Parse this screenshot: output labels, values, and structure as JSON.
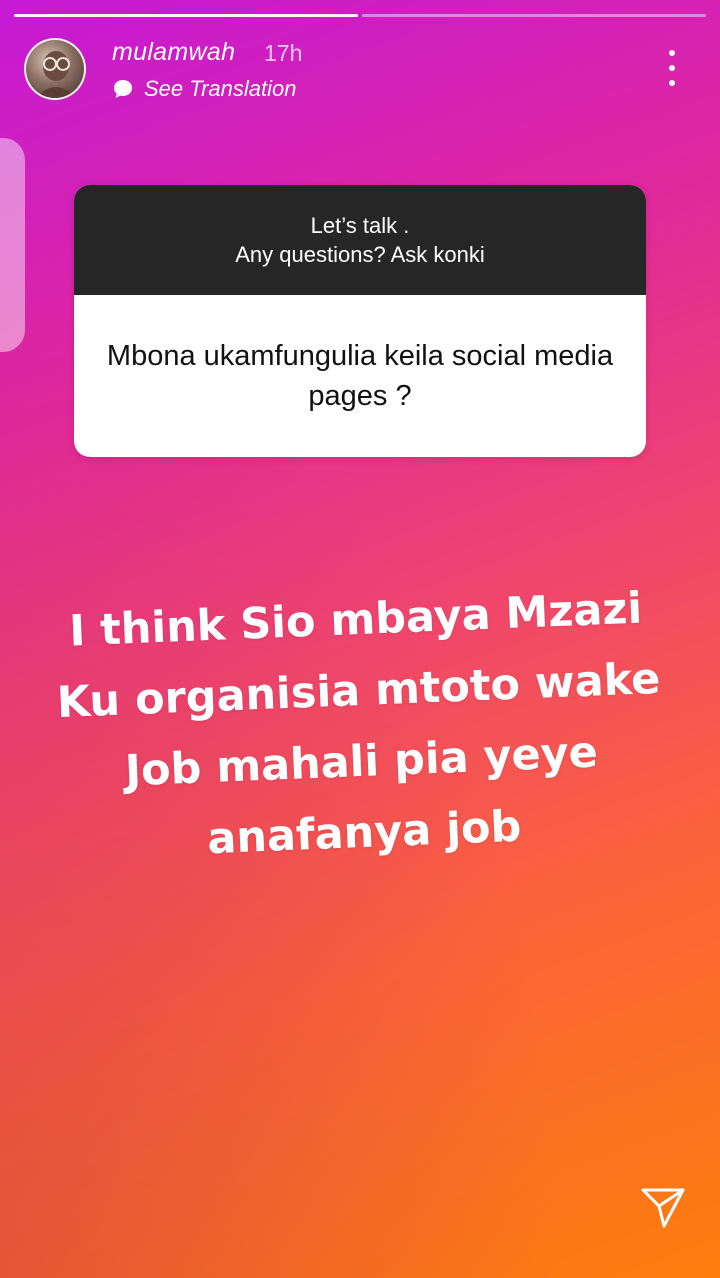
{
  "story": {
    "username": "mulamwah",
    "timestamp": "17h",
    "translation_label": "See Translation",
    "progress": {
      "segments": 2,
      "completed": 1
    }
  },
  "question_sticker": {
    "prompt_line1": "Let’s talk .",
    "prompt_line2": "Any questions? Ask konki",
    "question": "Mbona ukamfungulia keila social media pages ?"
  },
  "answer_text": {
    "line1": "I think Sio mbaya Mzazi",
    "line2": "Ku organisia mtoto wake",
    "line3": "Job mahali pia yeye",
    "line4": "anafanya job"
  },
  "icons": {
    "more": "more-vertical-icon",
    "send": "send-icon",
    "translate": "speech-bubble-icon"
  },
  "colors": {
    "gradient_start": "#c519d6",
    "gradient_end": "#fd7d0c",
    "sticker_header": "#262626"
  }
}
